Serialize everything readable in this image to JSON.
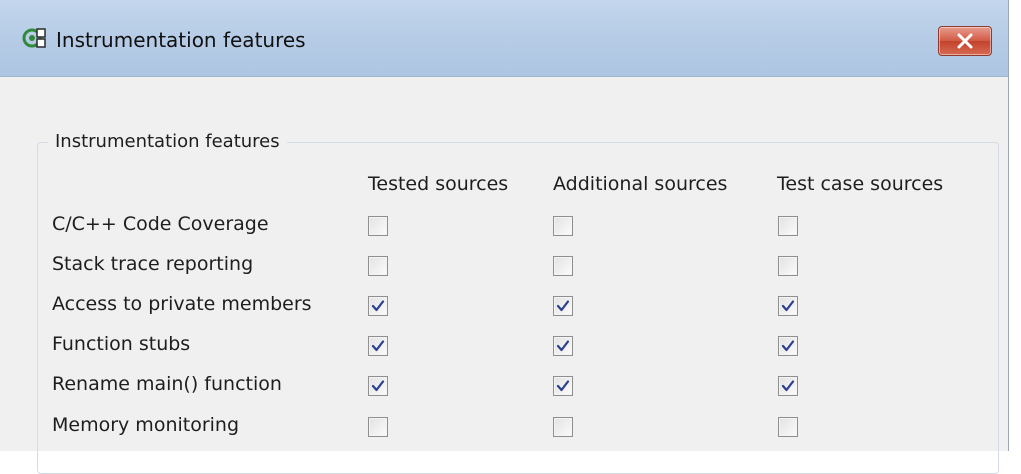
{
  "window": {
    "title": "Instrumentation features",
    "app_icon": "settings-gear-icon",
    "close_icon": "close-icon"
  },
  "group": {
    "legend": "Instrumentation features",
    "columns": [
      "Tested sources",
      "Additional sources",
      "Test case sources"
    ],
    "rows": [
      {
        "label": "C/C++ Code Coverage",
        "checks": [
          false,
          false,
          false
        ]
      },
      {
        "label": "Stack trace reporting",
        "checks": [
          false,
          false,
          false
        ]
      },
      {
        "label": "Access to private members",
        "checks": [
          true,
          true,
          true
        ]
      },
      {
        "label": "Function stubs",
        "checks": [
          true,
          true,
          true
        ]
      },
      {
        "label": "Rename main() function",
        "checks": [
          true,
          true,
          true
        ]
      },
      {
        "label": "Memory monitoring",
        "checks": [
          false,
          false,
          false
        ]
      }
    ]
  },
  "colors": {
    "titlebar": "#b4cae5",
    "close_button": "#d25a44",
    "check_mark": "#2a3f8f"
  }
}
